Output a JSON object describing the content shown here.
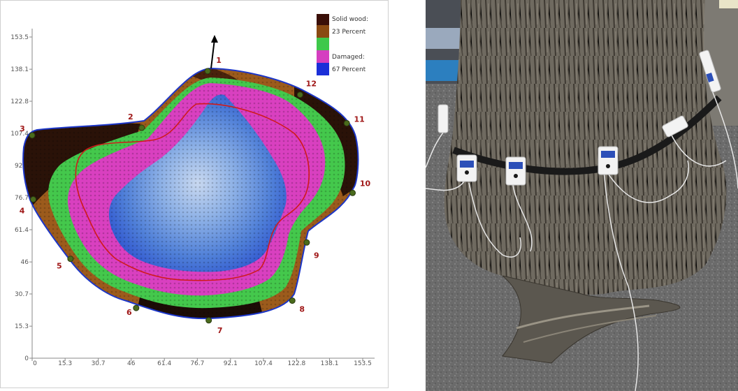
{
  "chart_data": {
    "type": "heatmap",
    "title": "",
    "x_ticks": [
      "0",
      "15.3",
      "30.7",
      "46",
      "61.4",
      "76.7",
      "92.1",
      "107.4",
      "122.8",
      "138.1",
      "153.5"
    ],
    "y_ticks": [
      "0",
      "15.3",
      "30.7",
      "46",
      "61.4",
      "76.7",
      "92.1",
      "107.4",
      "122.8",
      "138.1",
      "153.5"
    ],
    "xlim": [
      0,
      153.5
    ],
    "ylim": [
      0,
      153.5
    ],
    "grid": false,
    "legend_position": "top-right",
    "legend": [
      {
        "label": "Solid wood:",
        "color": "#3a0f08"
      },
      {
        "label": "23 Percent",
        "color": "#8a4a12"
      },
      {
        "label": "",
        "color": "#3ec84a"
      },
      {
        "label": "Damaged:",
        "color": "#d53ec0"
      },
      {
        "label": "67 Percent",
        "color": "#1b2fd8"
      }
    ],
    "sensors": [
      {
        "label": "1",
        "x": 81.5,
        "y": 137.2
      },
      {
        "label": "12",
        "x": 124.4,
        "y": 125.9
      },
      {
        "label": "11",
        "x": 146.1,
        "y": 112.3
      },
      {
        "label": "10",
        "x": 148.8,
        "y": 79.0
      },
      {
        "label": "9",
        "x": 127.5,
        "y": 55.3
      },
      {
        "label": "8",
        "x": 120.8,
        "y": 27.5
      },
      {
        "label": "7",
        "x": 82.0,
        "y": 18.1
      },
      {
        "label": "6",
        "x": 48.3,
        "y": 24.0
      },
      {
        "label": "5",
        "x": 17.8,
        "y": 47.5
      },
      {
        "label": "4",
        "x": 0.5,
        "y": 75.9
      },
      {
        "label": "3",
        "x": 0.0,
        "y": 106.5
      },
      {
        "label": "2",
        "x": 50.9,
        "y": 110.1
      }
    ],
    "damage_percent": 67,
    "solid_wood_percent": 23
  }
}
